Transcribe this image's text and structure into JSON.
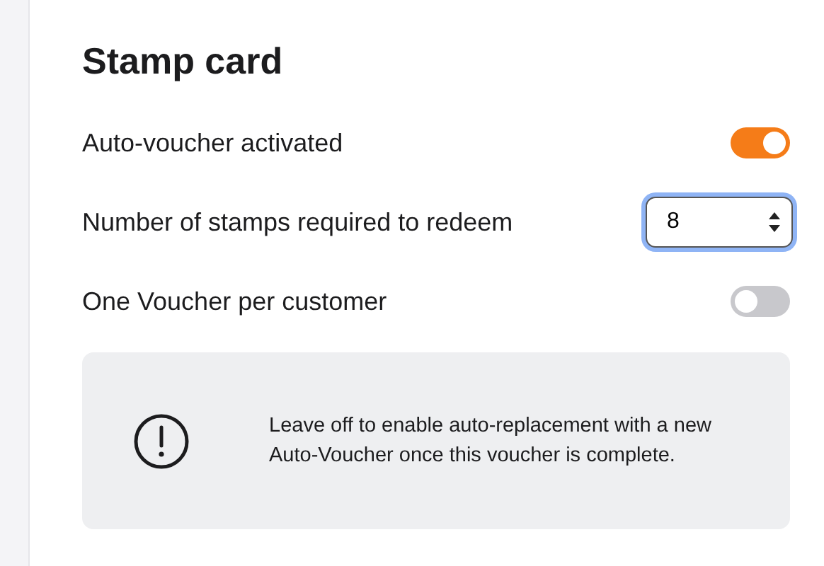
{
  "title": "Stamp card",
  "settings": [
    {
      "kind": "toggle",
      "label": "Auto-voucher activated",
      "on": true
    },
    {
      "kind": "select",
      "label": "Number of stamps required to redeem",
      "value": "8",
      "focused": true
    },
    {
      "kind": "toggle",
      "label": "One Voucher per customer",
      "on": false
    }
  ],
  "info": {
    "text": "Leave off to enable auto-replacement with a new Auto-Voucher once this voucher is complete."
  }
}
